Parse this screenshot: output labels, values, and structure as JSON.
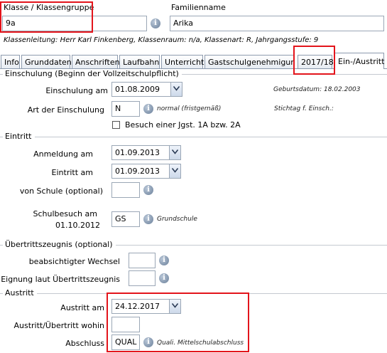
{
  "header": {
    "class_label": "Klasse / Klassengruppe",
    "class_value": "9a",
    "family_label": "Familienname",
    "family_value": "Arika",
    "info_line": "Klassenleitung: Herr Karl Finkenberg, Klassenraum: n/a, Klassenart: R, Jahrgangsstufe: 9"
  },
  "tabs": [
    {
      "label": "Info"
    },
    {
      "label": "Grunddaten"
    },
    {
      "label": "Anschriften"
    },
    {
      "label": "Laufbahn"
    },
    {
      "label": "Unterricht"
    },
    {
      "label": "Gastschulgenehmigung"
    },
    {
      "label": "2017/18"
    },
    {
      "label": "Ein-/Austritt"
    }
  ],
  "active_tab": "Ein-/Austritt",
  "einschulung": {
    "title": "Einschulung (Beginn der Vollzeitschulpflicht)",
    "date_label": "Einschulung am",
    "date_value": "01.08.2009",
    "art_label": "Art der Einschulung",
    "art_value": "N",
    "art_hint": "normal (fristgemäß)",
    "birth_hint": "Geburtsdatum: 18.02.2003",
    "stichtag_hint": "Stichtag f. Einsch.:",
    "checkbox_label": "Besuch einer Jgst. 1A bzw. 2A",
    "checkbox_checked": false
  },
  "eintritt": {
    "title": "Eintritt",
    "anmeldung_label": "Anmeldung am",
    "anmeldung_value": "01.09.2013",
    "eintritt_label": "Eintritt am",
    "eintritt_value": "01.09.2013",
    "von_schule_label": "von Schule (optional)",
    "von_schule_value": "",
    "schulbesuch_label_1": "Schulbesuch am",
    "schulbesuch_label_2": "01.10.2012",
    "schulbesuch_value": "GS",
    "schulbesuch_hint": "Grundschule"
  },
  "uebertritt": {
    "title": "Übertrittszeugnis (optional)",
    "wechsel_label": "beabsichtigter Wechsel",
    "wechsel_value": "",
    "eignung_label": "Eignung laut Übertrittszeugnis",
    "eignung_value": ""
  },
  "austritt": {
    "title": "Austritt",
    "date_label": "Austritt am",
    "date_value": "24.12.2017",
    "wohin_label": "Austritt/Übertritt wohin",
    "wohin_value": "",
    "abschluss_label": "Abschluss",
    "abschluss_value": "QUAL",
    "abschluss_hint": "Quali. Mittelschulabschluss"
  },
  "icons": {
    "info": "info-icon",
    "dropdown": "chevron-down-icon"
  },
  "colors": {
    "highlight": "#e3141b",
    "border": "#9ba7b6",
    "info_icon": "#6a7f99"
  }
}
